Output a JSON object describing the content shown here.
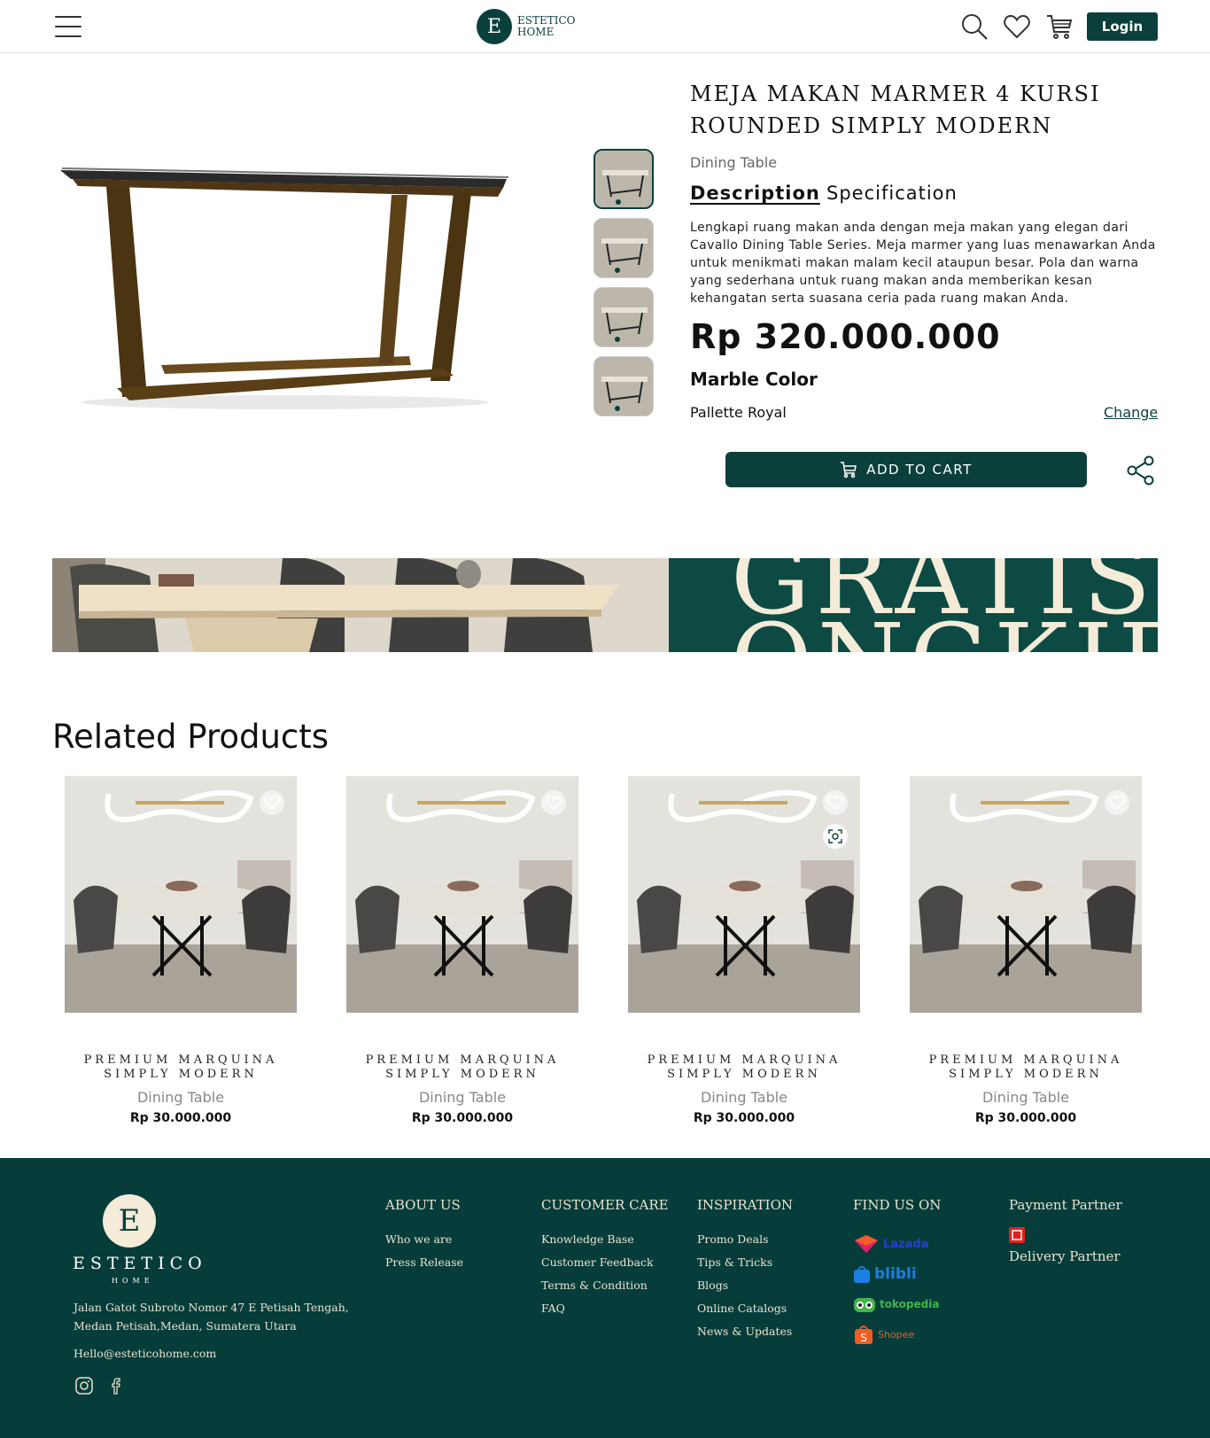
{
  "header": {
    "logo_letter": "E",
    "logo_line1": "ESTETICO",
    "logo_line2": "HOME",
    "login_label": "Login",
    "icons": [
      "menu-icon",
      "search-icon",
      "heart-icon",
      "cart-icon"
    ]
  },
  "product": {
    "title": "MEJA MAKAN MARMER 4 KURSI ROUNDED SIMPLY MODERN",
    "category": "Dining Table",
    "tabs": [
      {
        "label": "Description",
        "active": true
      },
      {
        "label": "Specification",
        "active": false
      }
    ],
    "description": "Lengkapi ruang makan anda dengan meja makan yang elegan dari Cavallo Dining Table Series. Meja marmer yang luas menawarkan Anda untuk menikmati makan malam kecil ataupun besar. Pola dan warna yang sederhana untuk ruang makan anda memberikan kesan kehangatan serta suasana ceria pada ruang makan Anda.",
    "price": "Rp 320.000.000",
    "option_label": "Marble Color",
    "option_value": "Pallette Royal",
    "change_label": "Change",
    "add_to_cart_label": "ADD TO CART",
    "thumbnail_count": 4
  },
  "banner": {
    "text": "GRATIS ONGKIR"
  },
  "related": {
    "title": "Related Products",
    "items": [
      {
        "name": "PREMIUM MARQUINA SIMPLY MODERN",
        "category": "Dining Table",
        "price": "Rp 30.000.000"
      },
      {
        "name": "PREMIUM MARQUINA SIMPLY MODERN",
        "category": "Dining Table",
        "price": "Rp 30.000.000"
      },
      {
        "name": "PREMIUM MARQUINA SIMPLY MODERN",
        "category": "Dining Table",
        "price": "Rp 30.000.000"
      },
      {
        "name": "PREMIUM MARQUINA SIMPLY MODERN",
        "category": "Dining Table",
        "price": "Rp 30.000.000"
      }
    ]
  },
  "footer": {
    "brand_letter": "E",
    "brand_name": "ESTETICO",
    "brand_sub": "HOME",
    "address": "Jalan Gatot Subroto Nomor 47 E Petisah Tengah, Medan Petisah,Medan, Sumatera Utara",
    "email": "Hello@esteticohome.com",
    "about": {
      "heading": "ABOUT US",
      "links": [
        "Who we are",
        "Press Release"
      ]
    },
    "care": {
      "heading": "CUSTOMER CARE",
      "links": [
        "Knowledge Base",
        "Customer Feedback",
        "Terms & Condition",
        "FAQ"
      ]
    },
    "inspiration": {
      "heading": "INSPIRATION",
      "links": [
        "Promo Deals",
        "Tips & Tricks",
        "Blogs",
        "Online Catalogs",
        "News & Updates"
      ]
    },
    "find_us": {
      "heading": "FIND US ON",
      "shops": [
        "Lazada",
        "blibli",
        "tokopedia",
        "Shopee"
      ]
    },
    "payment_heading": "Payment Partner",
    "delivery_heading": "Delivery Partner"
  },
  "colors": {
    "brand": "#0b3f3c",
    "footer_bg": "#063d3a",
    "cream": "#f4ecd8"
  }
}
